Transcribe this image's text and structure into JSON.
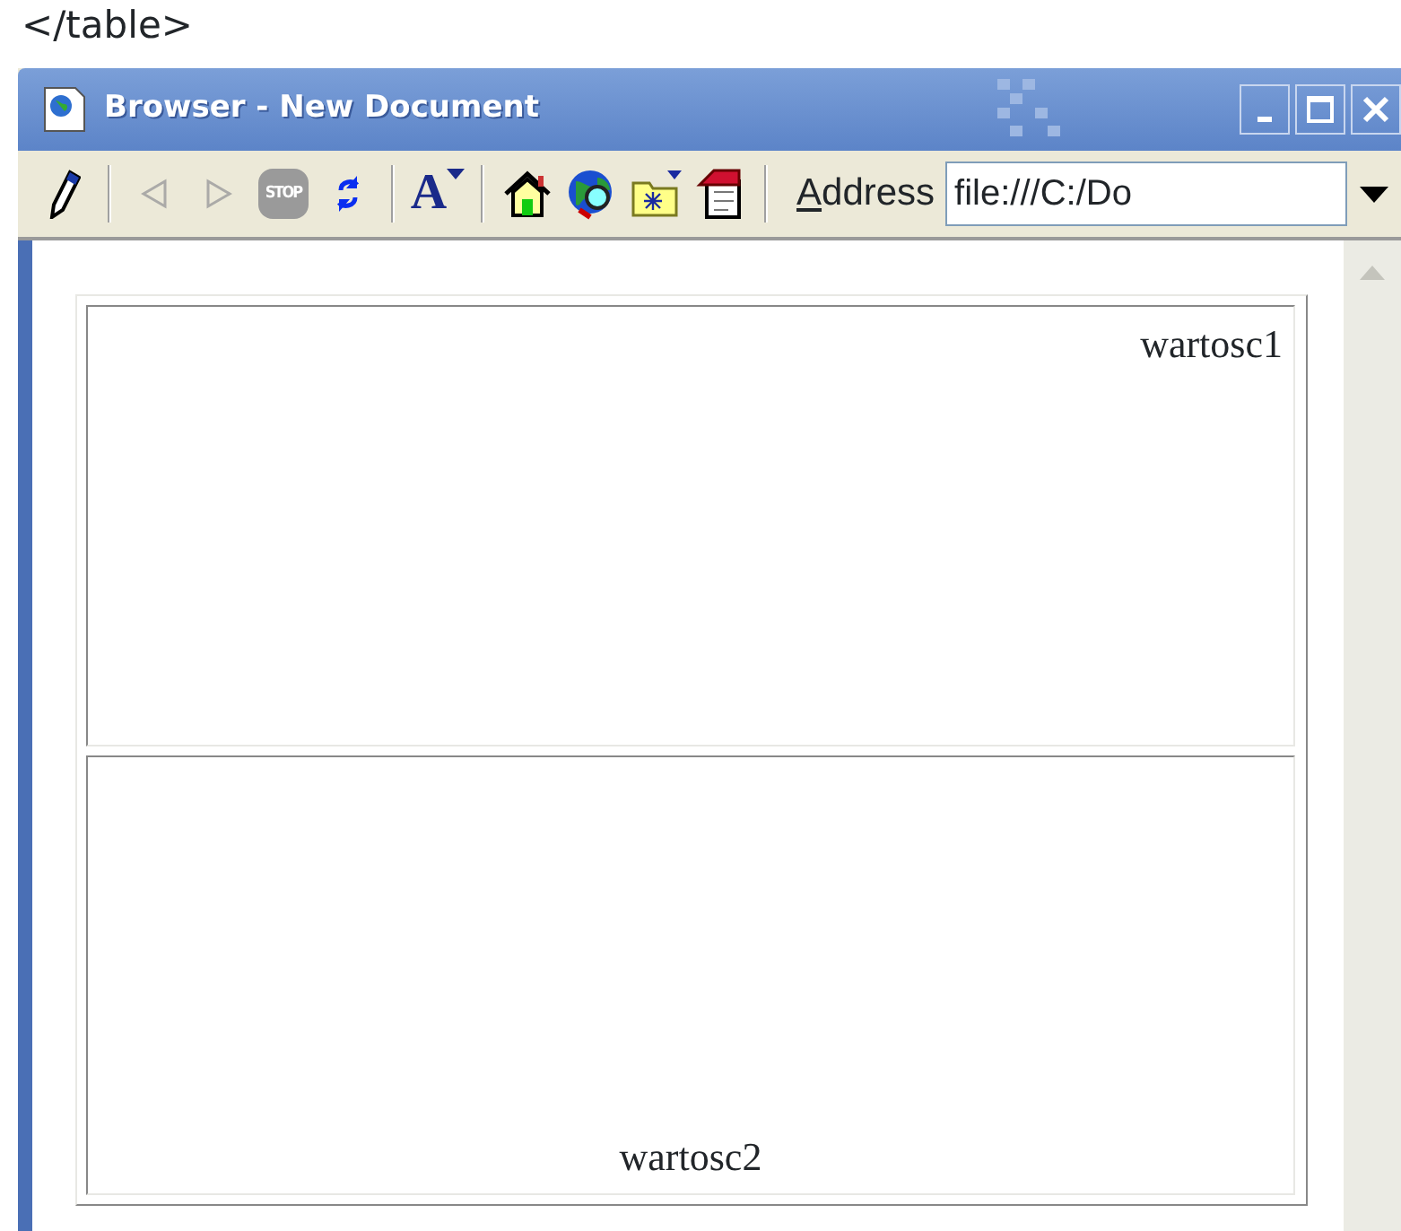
{
  "caption": "</table>",
  "window": {
    "title": "Browser - New Document"
  },
  "toolbar": [
    {
      "kind": "pencil",
      "disabled": false
    },
    {
      "kind": "separator"
    },
    {
      "kind": "back",
      "disabled": true
    },
    {
      "kind": "forward",
      "disabled": true
    },
    {
      "kind": "stop",
      "disabled": true,
      "glyph": "STOP"
    },
    {
      "kind": "refresh",
      "disabled": false
    },
    {
      "kind": "separator"
    },
    {
      "kind": "font",
      "disabled": false,
      "glyph": "A"
    },
    {
      "kind": "separator"
    },
    {
      "kind": "home",
      "disabled": false
    },
    {
      "kind": "globe",
      "disabled": false
    },
    {
      "kind": "folder",
      "disabled": false
    },
    {
      "kind": "notepad",
      "disabled": false
    },
    {
      "kind": "separator"
    }
  ],
  "address": {
    "label": "Address",
    "mnemonic": true,
    "value": "file:///C:/Do"
  },
  "table": {
    "rows": [
      {
        "text": "wartosc1",
        "kind": "top"
      },
      {
        "text": "wartosc2",
        "kind": "bottom"
      }
    ]
  }
}
